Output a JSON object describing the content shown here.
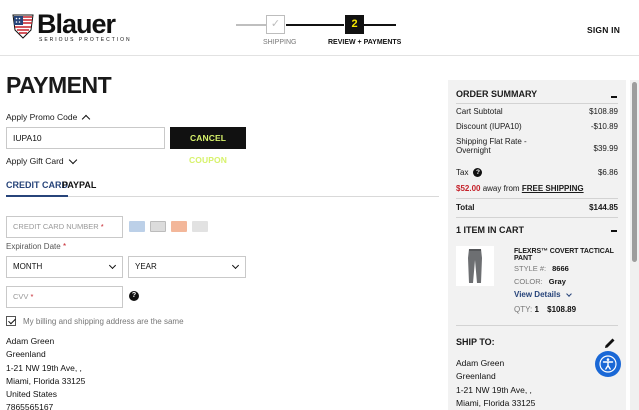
{
  "header": {
    "logo_text": "Blauer",
    "logo_tagline": "SERIOUS PROTECTION",
    "steps": [
      {
        "number": "✓",
        "label": "SHIPPING"
      },
      {
        "number": "2",
        "label": "REVIEW + PAYMENTS"
      }
    ],
    "sign_in": "SIGN IN"
  },
  "payment": {
    "title": "PAYMENT",
    "promo_toggle": "Apply Promo Code",
    "promo_value": "IUPA10",
    "cancel_coupon": "CANCEL COUPON",
    "gift_toggle": "Apply Gift Card",
    "tabs": [
      "CREDIT CARD",
      "PAYPAL"
    ],
    "card_number_placeholder": "CREDIT CARD NUMBER",
    "expiration_label": "Expiration Date",
    "month_selected": "MONTH",
    "year_selected": "YEAR",
    "cvv_placeholder": "CVV",
    "required_mark": "*",
    "help_glyph": "?",
    "billing_same_label": "My billing and shipping address are the same",
    "billing_address": [
      "Adam Green",
      "Greenland",
      "1-21 NW 19th Ave, ,",
      "Miami, Florida 33125",
      "United States",
      "7865565167"
    ]
  },
  "summary": {
    "title": "ORDER SUMMARY",
    "rows": [
      {
        "label": "Cart Subtotal",
        "value": "$108.89"
      },
      {
        "label": "Discount (IUPA10)",
        "value": "-$10.89"
      },
      {
        "label": "Shipping Flat Rate -",
        "label2": "Overnight",
        "value": "$39.99"
      },
      {
        "label": "Tax",
        "value": "$6.86"
      }
    ],
    "free_shipping_amount": "$52.00",
    "free_shipping_text": " away from ",
    "free_shipping_link": "FREE SHIPPING",
    "total_label": "Total",
    "total_value": "$144.85",
    "items_title": "1 ITEM IN CART",
    "product": {
      "name": "FLEXRS™ COVERT TACTICAL PANT",
      "style_label": "STYLE #:",
      "style_value": "8666",
      "color_label": "COLOR:",
      "color_value": "Gray",
      "details_link": "View Details",
      "qty_label": "QTY:",
      "qty_value": "1",
      "price": "$108.89"
    },
    "ship_to_title": "SHIP TO:",
    "ship_to_address": [
      "Adam Green",
      "Greenland",
      "1-21 NW 19th Ave, ,",
      "Miami, Florida 33125"
    ]
  },
  "colors": {
    "accent_blue": "#27447a",
    "promo_red": "#c5212a",
    "coupon_text": "#d7f26b",
    "accessibility_blue": "#1a68d6"
  }
}
